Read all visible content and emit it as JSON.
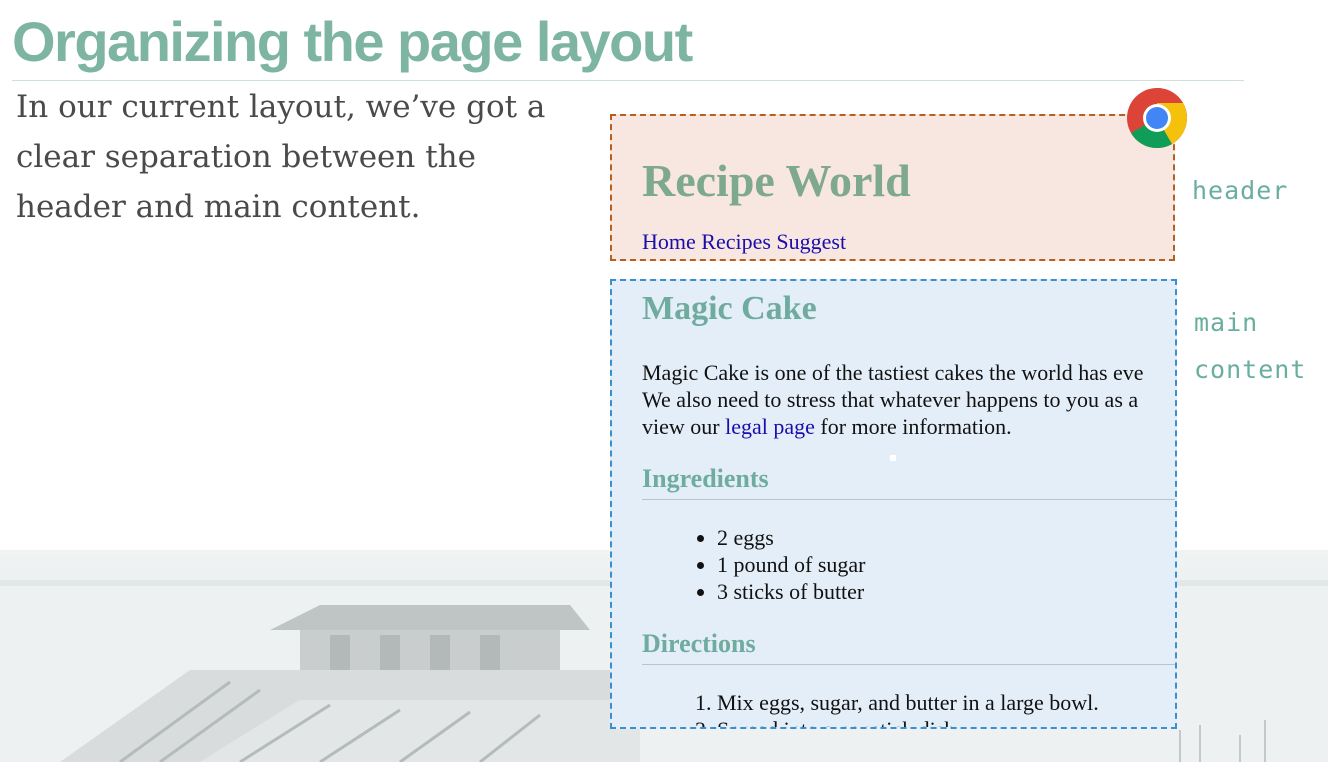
{
  "slide": {
    "title": "Organizing the page layout",
    "intro_line1": "In our current layout, we’ve got a",
    "intro_line2": "clear separation between the",
    "intro_line3": "header and main content."
  },
  "annotations": {
    "header": "header",
    "main_line1": "main",
    "main_line2": "content"
  },
  "recipe_page": {
    "site_title": "Recipe World",
    "nav": [
      "Home",
      "Recipes",
      "Suggest"
    ],
    "main_title": "Magic Cake",
    "para_line1": "Magic Cake is one of the tastiest cakes the world has eve",
    "para_line2": "We also need to stress that whatever happens to you as a",
    "para_line3_before": "view our ",
    "para_link": "legal page",
    "para_line3_after": " for more information.",
    "ingredients_title": "Ingredients",
    "ingredients": [
      "2 eggs",
      "1 pound of sugar",
      "3 sticks of butter"
    ],
    "directions_title": "Directions",
    "directions": [
      "Mix eggs, sugar, and butter in a large bowl.",
      "Spread into a nonstick dish"
    ]
  },
  "colors": {
    "accent": "#7db5a2",
    "header_fill": "#f8e7e0",
    "header_border": "#b65f22",
    "main_fill": "#e4eef8",
    "main_border": "#3d8fcc",
    "link": "#1a0dab"
  },
  "icons": {
    "browser_logo": "chrome-logo-icon"
  }
}
